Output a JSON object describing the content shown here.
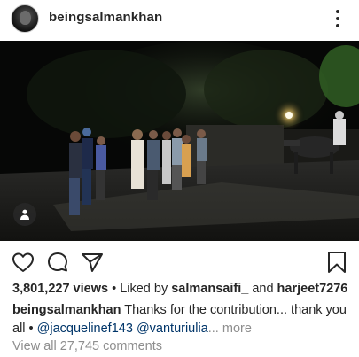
{
  "post": {
    "username": "beingsalmankhan"
  },
  "engagement": {
    "views": "3,801,227 views",
    "separator": " • ",
    "liked_by_prefix": "Liked by ",
    "liked_by_user": "salmansaifi_",
    "and_text": " and ",
    "other_user": "harjeet7276"
  },
  "caption": {
    "author": "beingsalmankhan",
    "text": " Thanks for the contribution... thank you all",
    "bullet": " • ",
    "mention_1": "@jacquelinef143",
    "mention_2": "@vanturiulia",
    "truncation": "...",
    "more_label": " more"
  },
  "comments": {
    "view_all_label": "View all 27,745 comments"
  },
  "icons": {
    "more": "more-vertical-icon",
    "like": "heart-icon",
    "comment": "comment-bubble-icon",
    "share": "paper-plane-icon",
    "save": "bookmark-icon",
    "tag": "user-tag-icon"
  },
  "colors": {
    "text": "#262626",
    "muted": "#8e8e8e",
    "mention": "#003569"
  }
}
